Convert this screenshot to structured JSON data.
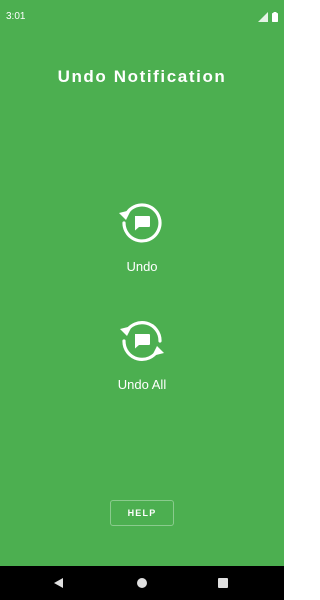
{
  "status_bar": {
    "time": "3:01",
    "icons": [
      "signal-icon",
      "battery-icon"
    ]
  },
  "app": {
    "title": "Undo Notification"
  },
  "actions": [
    {
      "label": "Undo",
      "icon": "undo-notification-icon"
    },
    {
      "label": "Undo All",
      "icon": "undo-all-notifications-icon"
    }
  ],
  "help_button": {
    "label": "HELP"
  },
  "nav_bar": {
    "buttons": [
      "back-icon",
      "home-icon",
      "recents-icon"
    ]
  },
  "colors": {
    "background": "#4caf50",
    "text": "#ffffff",
    "nav_bar": "#000000"
  }
}
